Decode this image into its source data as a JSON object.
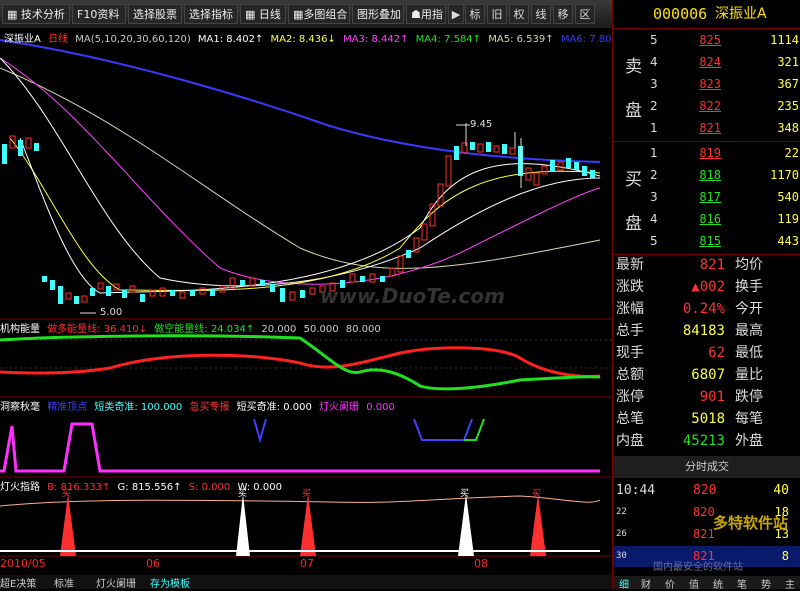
{
  "toolbar": {
    "items": [
      "技术分析",
      "F10资料",
      "选择股票",
      "选择指标",
      "日线",
      "多图组合",
      "图形叠加",
      "用指",
      "标",
      "旧",
      "权",
      "线",
      "移",
      "区"
    ]
  },
  "chart": {
    "stock_title": "深振业A",
    "period": "日线",
    "ma_legend": [
      "MA(5,10,20,30,60,120)",
      "MA1: 8.402↑",
      "MA2: 8.436↓",
      "MA3: 8.442↑",
      "MA4: 7.584↑",
      "MA5: 6.539↑",
      "MA6: 7.800↑"
    ],
    "high_label": "9.45",
    "low_label": "5.00",
    "watermark": "www.DuoTe.com",
    "ind1_legend": [
      "机构能量",
      "做多能量线: 36.410↓",
      "做空能量线: 24.034↑",
      "20.000",
      "50.000",
      "80.000"
    ],
    "ind2_legend": [
      "洞察秋毫",
      "精准顶点",
      "短类奇准: 100.000",
      "急买专报",
      "短买奇准: 0.000",
      "灯火阑珊",
      "0.000"
    ],
    "ind3_legend": [
      "灯火指路",
      "B: 816.333↑",
      "G: 815.556↑",
      "S: 0.000",
      "W: 0.000"
    ],
    "signal_label": "买",
    "dates": [
      "2010/05",
      "06",
      "07",
      "08"
    ],
    "bottom_tabs": [
      "超E决策",
      "标准",
      "灯火阑珊",
      "存为模板"
    ],
    "colors": {
      "candle_up": "#ff3030",
      "candle_down": "#40ffff",
      "long_line": "#ff2020",
      "short_line": "#20e020",
      "signal": "#ff30ff"
    }
  },
  "quote": {
    "code": "000006",
    "name": "深振业A",
    "sell_label": [
      "卖",
      "盘"
    ],
    "buy_label": [
      "买",
      "盘"
    ],
    "sell": [
      {
        "i": "5",
        "p": "825",
        "v": "1114"
      },
      {
        "i": "4",
        "p": "824",
        "v": "321"
      },
      {
        "i": "3",
        "p": "823",
        "v": "367"
      },
      {
        "i": "2",
        "p": "822",
        "v": "235"
      },
      {
        "i": "1",
        "p": "821",
        "v": "348"
      }
    ],
    "buy": [
      {
        "i": "1",
        "p": "819",
        "v": "22"
      },
      {
        "i": "2",
        "p": "818",
        "v": "1170"
      },
      {
        "i": "3",
        "p": "817",
        "v": "540"
      },
      {
        "i": "4",
        "p": "816",
        "v": "119"
      },
      {
        "i": "5",
        "p": "815",
        "v": "443"
      }
    ],
    "stats": [
      {
        "k": "最新",
        "v": "821",
        "c": "#ff3030",
        "k2": "均价"
      },
      {
        "k": "涨跌",
        "v": "▲002",
        "c": "#ff3030",
        "k2": "换手"
      },
      {
        "k": "涨幅",
        "v": "0.24%",
        "c": "#ff3030",
        "k2": "今开"
      },
      {
        "k": "总手",
        "v": "84183",
        "c": "#ffff40",
        "k2": "最高"
      },
      {
        "k": "现手",
        "v": "62",
        "c": "#ff3030",
        "k2": "最低"
      },
      {
        "k": "总额",
        "v": "6807",
        "c": "#ffff40",
        "k2": "量比"
      },
      {
        "k": "涨停",
        "v": "901",
        "c": "#ff3030",
        "k2": "跌停"
      },
      {
        "k": "总笔",
        "v": "5018",
        "c": "#ffff40",
        "k2": "每笔"
      },
      {
        "k": "内盘",
        "v": "45213",
        "c": "#20e020",
        "k2": "外盘"
      }
    ],
    "tick_header": "分时成交",
    "ticks": [
      {
        "t": "10:44",
        "p": "820",
        "n": "40"
      },
      {
        "t": "22",
        "p": "820",
        "n": "18"
      },
      {
        "t": "26",
        "p": "821",
        "n": "13"
      },
      {
        "t": "30",
        "p": "821",
        "n": "8"
      }
    ],
    "tabs": [
      "细",
      "财",
      "价",
      "值",
      "统",
      "笔",
      "势",
      "主"
    ],
    "watermark": "多特软件站",
    "watermark2": "国内最安全的软件站"
  }
}
